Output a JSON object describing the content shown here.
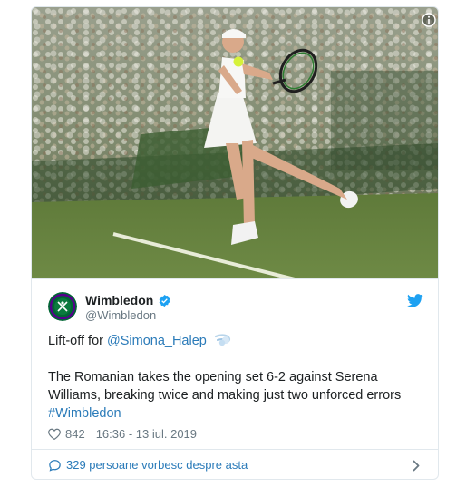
{
  "embed": {
    "author": {
      "display_name": "Wimbledon",
      "handle": "@Wimbledon",
      "verified": true
    },
    "photo_alt": "Simona Halep hitting a forehand on Wimbledon Centre Court",
    "text": {
      "line1_prefix": "Lift-off for ",
      "mention": "@Simona_Halep",
      "emoji": "dashing-away-emoji",
      "body": "The Romanian takes the opening set 6-2 against Serena Williams, breaking twice and making just two unforced errors",
      "hashtag": "#Wimbledon"
    },
    "meta": {
      "likes": "842",
      "timestamp": "16:36 - 13 iul. 2019"
    },
    "footer": {
      "conversation_label": "329 persoane vorbesc despre asta"
    },
    "icons": {
      "info": "info-icon",
      "verified": "verified-badge-icon",
      "twitter": "twitter-bird-icon",
      "heart": "heart-icon",
      "comment": "speech-bubble-icon",
      "chevron": "chevron-right-icon"
    },
    "colors": {
      "link": "#2b7bb9",
      "secondary_text": "#697882",
      "twitter_blue": "#1da1f2",
      "border": "#e1e8ed",
      "wimbledon_green": "#006633",
      "wimbledon_purple": "#54008b"
    }
  }
}
